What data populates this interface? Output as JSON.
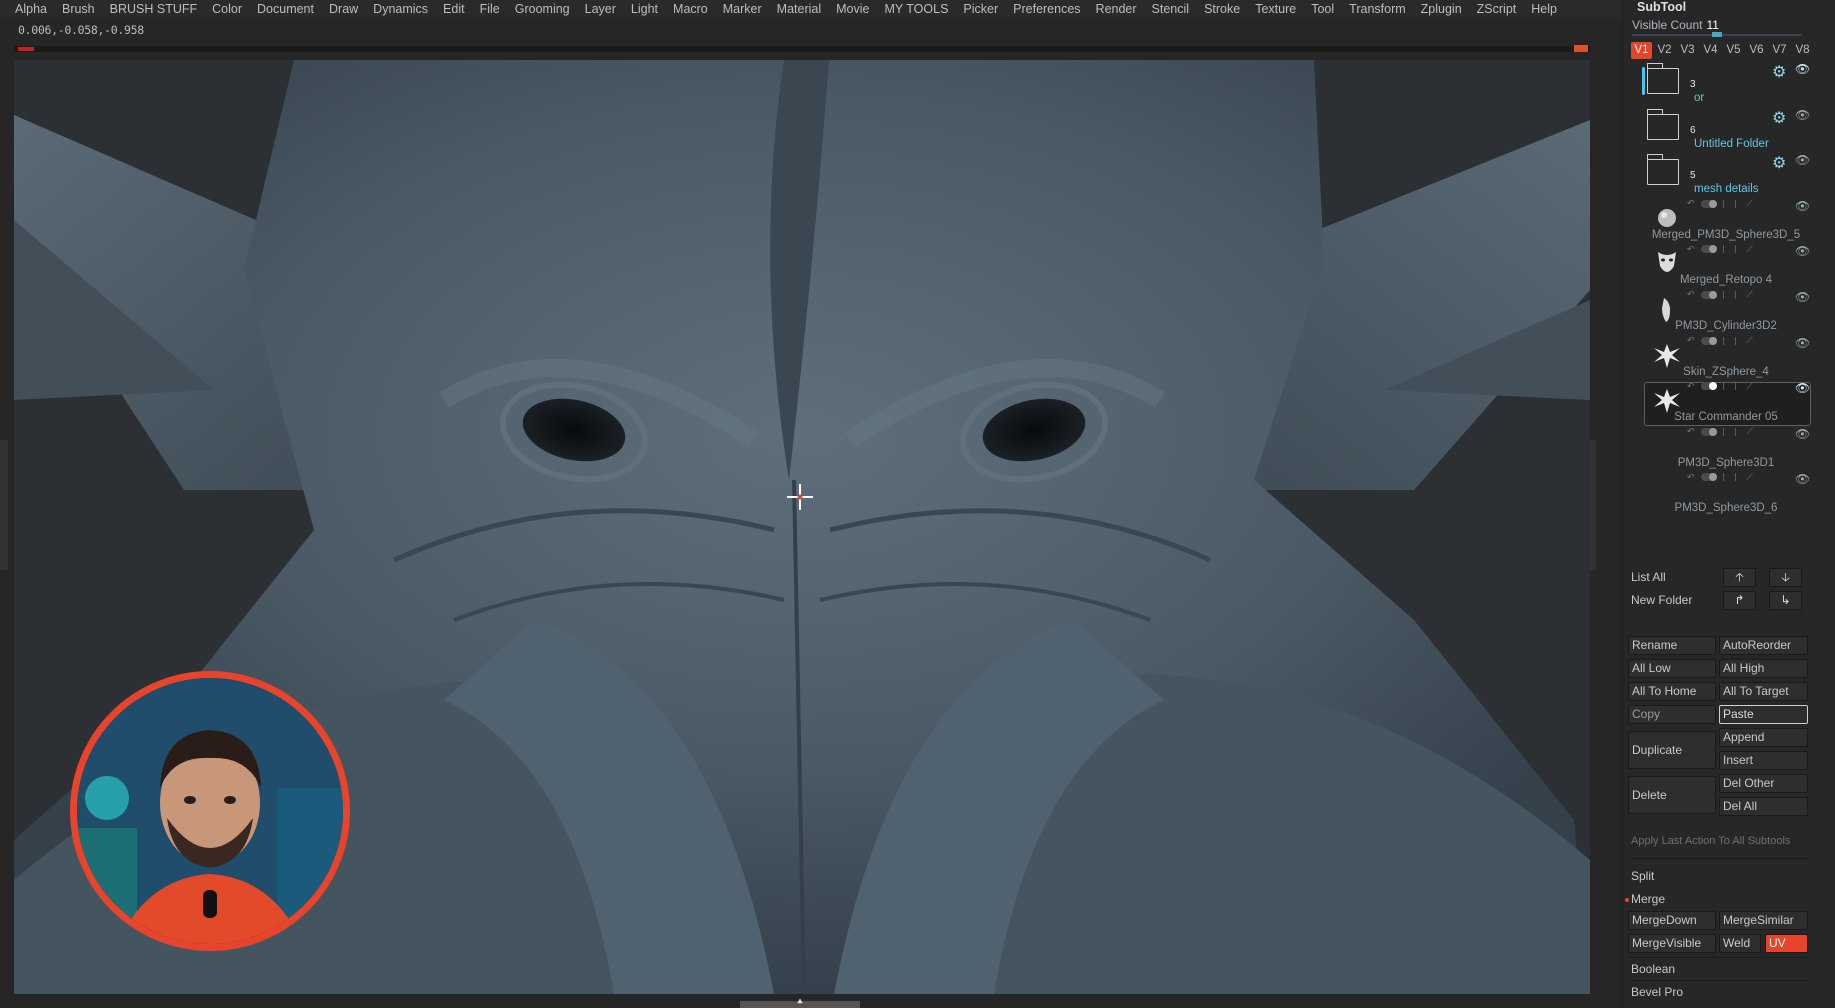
{
  "menu": [
    "Alpha",
    "Brush",
    "BRUSH STUFF",
    "Color",
    "Document",
    "Draw",
    "Dynamics",
    "Edit",
    "File",
    "Grooming",
    "Layer",
    "Light",
    "Macro",
    "Marker",
    "Material",
    "Movie",
    "MY TOOLS",
    "Picker",
    "Preferences",
    "Render",
    "Stencil",
    "Stroke",
    "Texture",
    "Tool",
    "Transform",
    "Zplugin",
    "ZScript",
    "Help"
  ],
  "coords": "0.006,-0.058,-0.958",
  "panel": {
    "title": "SubTool",
    "visible_count_label": "Visible Count",
    "visible_count": "11",
    "vtabs": [
      "V1",
      "V2",
      "V3",
      "V4",
      "V5",
      "V6",
      "V7",
      "V8"
    ],
    "active_vtab": "V1",
    "folders": [
      {
        "count": "3",
        "name": "or"
      },
      {
        "count": "6",
        "name": "Untitled Folder"
      },
      {
        "count": "5",
        "name": "mesh details"
      }
    ],
    "subtools": [
      {
        "name": "Merged_PM3D_Sphere3D_5",
        "thumb": "sphere-merged-thumbnail"
      },
      {
        "name": "Merged_Retopo 4",
        "thumb": "mask-thumbnail"
      },
      {
        "name": "PM3D_Cylinder3D2",
        "thumb": "cylinder-thumbnail"
      },
      {
        "name": "Skin_ZSphere_4",
        "thumb": "creature-thumbnail"
      },
      {
        "name": "Star Commander 05",
        "thumb": "creature-thumbnail",
        "selected": true
      },
      {
        "name": "PM3D_Sphere3D1",
        "thumb": ""
      },
      {
        "name": "PM3D_Sphere3D_6",
        "thumb": ""
      }
    ],
    "list_all": "List All",
    "new_folder": "New Folder",
    "buttons": {
      "rename": "Rename",
      "auto_reorder": "AutoReorder",
      "all_low": "All Low",
      "all_high": "All High",
      "all_to_home": "All To Home",
      "all_to_target": "All To Target",
      "copy": "Copy",
      "paste": "Paste",
      "duplicate": "Duplicate",
      "append": "Append",
      "insert": "Insert",
      "delete": "Delete",
      "del_other": "Del Other",
      "del_all": "Del All",
      "apply_last": "Apply Last Action To All Subtools",
      "split": "Split",
      "merge": "Merge",
      "merge_down": "MergeDown",
      "merge_similar": "MergeSimilar",
      "merge_visible": "MergeVisible",
      "weld": "Weld",
      "uv": "UV",
      "boolean": "Boolean",
      "bevel_pro": "Bevel Pro"
    }
  },
  "colors": {
    "accent": "#e8432b",
    "mesh": "#4b5a66",
    "panel": "#272727"
  }
}
